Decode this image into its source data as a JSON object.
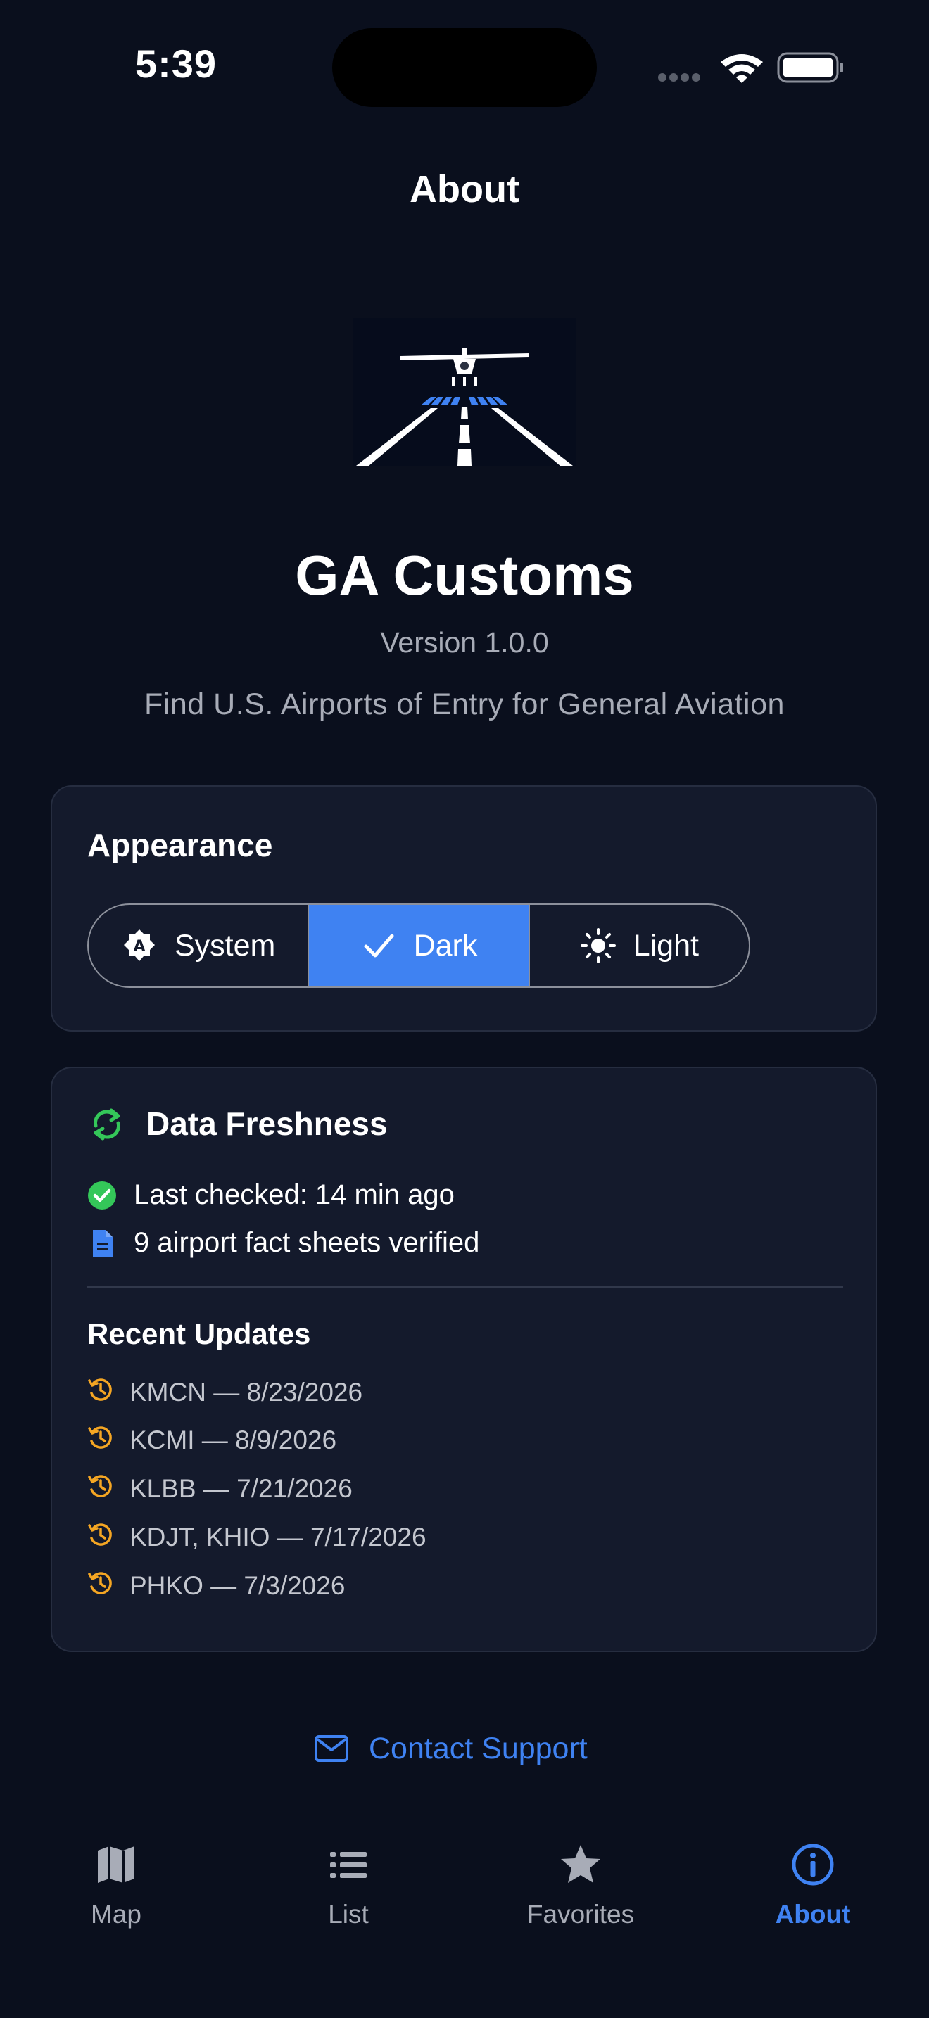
{
  "status_bar": {
    "time": "5:39"
  },
  "nav": {
    "title": "About"
  },
  "app": {
    "name": "GA Customs",
    "version": "Version 1.0.0",
    "tagline": "Find U.S. Airports of Entry for General Aviation"
  },
  "appearance": {
    "title": "Appearance",
    "options": [
      {
        "label": "System",
        "icon": "auto-badge-icon"
      },
      {
        "label": "Dark",
        "icon": "checkmark-icon"
      },
      {
        "label": "Light",
        "icon": "sun-icon"
      }
    ],
    "selected": "Dark"
  },
  "freshness": {
    "title": "Data Freshness",
    "last_checked": "Last checked: 14 min ago",
    "verified": "9 airport fact sheets verified",
    "recent_title": "Recent Updates",
    "updates": [
      "KMCN — 8/23/2026",
      "KCMI — 8/9/2026",
      "KLBB — 7/21/2026",
      "KDJT, KHIO — 7/17/2026",
      "PHKO — 7/3/2026"
    ]
  },
  "contact": {
    "label": "Contact Support"
  },
  "tabs": [
    {
      "label": "Map",
      "icon": "map-icon"
    },
    {
      "label": "List",
      "icon": "list-icon"
    },
    {
      "label": "Favorites",
      "icon": "star-icon"
    },
    {
      "label": "About",
      "icon": "info-icon"
    }
  ],
  "active_tab": "About",
  "colors": {
    "background": "#0a0f1d",
    "card": "#141a2c",
    "accent": "#3f82f2",
    "success": "#34c759",
    "warning": "#f5a623"
  }
}
